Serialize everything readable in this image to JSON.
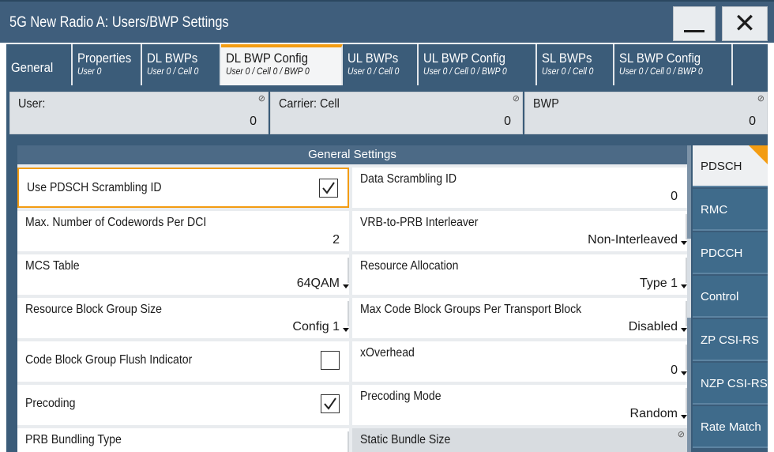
{
  "window": {
    "title": "5G New Radio A: Users/BWP Settings",
    "minimize_label": "",
    "close_label": "✕"
  },
  "tabs": [
    {
      "name": "General",
      "sub": ""
    },
    {
      "name": "Properties",
      "sub": "User 0"
    },
    {
      "name": "DL BWPs",
      "sub": "User 0 / Cell 0"
    },
    {
      "name": "DL BWP Config",
      "sub": "User 0 / Cell 0 / BWP 0"
    },
    {
      "name": "UL BWPs",
      "sub": "User 0 / Cell 0"
    },
    {
      "name": "UL BWP Config",
      "sub": "User 0 / Cell 0 / BWP 0"
    },
    {
      "name": "SL BWPs",
      "sub": "User 0 / Cell 0"
    },
    {
      "name": "SL BWP Config",
      "sub": "User 0 / Cell 0 / BWP 0"
    }
  ],
  "header": {
    "user": {
      "label": "User:",
      "value": "0"
    },
    "carrier": {
      "label": "Carrier: Cell",
      "value": "0"
    },
    "bwp": {
      "label": "BWP",
      "value": "0"
    }
  },
  "section": {
    "title": "General Settings"
  },
  "fields": {
    "use_pdsch_scrambling_id": {
      "label": "Use PDSCH Scrambling ID",
      "checked": true
    },
    "data_scrambling_id": {
      "label": "Data Scrambling ID",
      "value": "0"
    },
    "max_codewords": {
      "label": "Max. Number of Codewords Per DCI",
      "value": "2"
    },
    "vrb_to_prb": {
      "label": "VRB-to-PRB Interleaver",
      "value": "Non-Interleaved"
    },
    "mcs_table": {
      "label": "MCS Table",
      "value": "64QAM"
    },
    "resource_allocation": {
      "label": "Resource Allocation",
      "value": "Type 1"
    },
    "rbg_size": {
      "label": "Resource Block Group Size",
      "value": "Config 1"
    },
    "max_cbg": {
      "label": "Max Code Block Groups Per Transport Block",
      "value": "Disabled"
    },
    "cbg_flush": {
      "label": "Code Block Group Flush Indicator",
      "checked": false
    },
    "xoverhead": {
      "label": "xOverhead",
      "value": "0"
    },
    "precoding": {
      "label": "Precoding",
      "checked": true
    },
    "precoding_mode": {
      "label": "Precoding Mode",
      "value": "Random"
    },
    "prb_bundling_type": {
      "label": "PRB Bundling Type"
    },
    "static_bundle_size": {
      "label": "Static Bundle Size"
    }
  },
  "rightnav": [
    "PDSCH",
    "RMC",
    "PDCCH",
    "Control",
    "ZP CSI-RS",
    "NZP CSI-RS",
    "Rate Match"
  ],
  "colors": {
    "accent": "#f39c12",
    "panel": "#3b5c79",
    "nav": "#3f6b8b"
  }
}
